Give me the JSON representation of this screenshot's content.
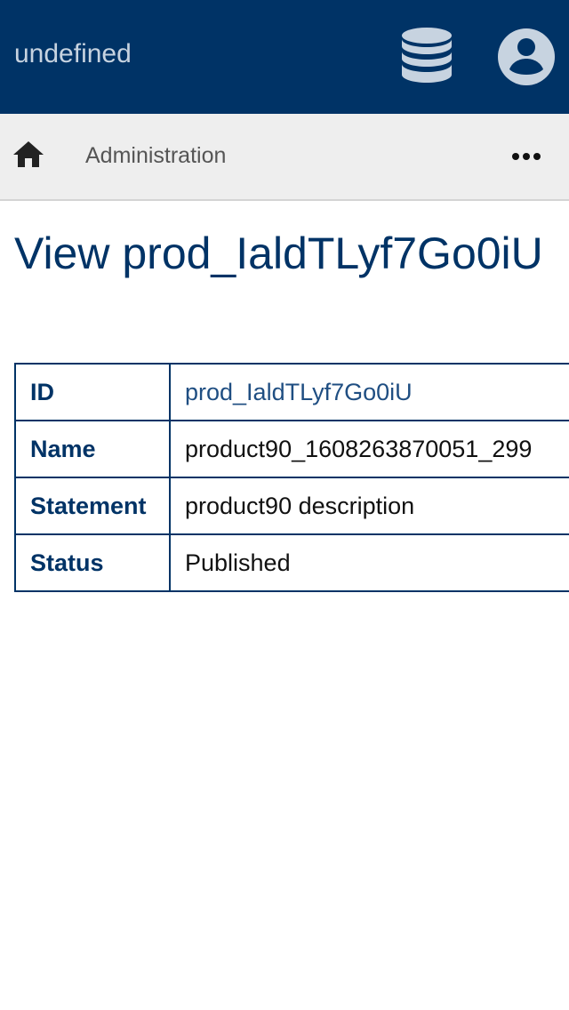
{
  "header": {
    "app_title": "undefined",
    "database_icon": "database-icon",
    "account_icon": "account-circle-icon"
  },
  "breadcrumb": {
    "home_icon": "home-icon",
    "items": [
      {
        "label": "Administration"
      }
    ],
    "more_icon": "more-horizontal-icon"
  },
  "main": {
    "title": "View prod_IaldTLyf7Go0iU",
    "details": [
      {
        "label": "ID",
        "value": "prod_IaldTLyf7Go0iU"
      },
      {
        "label": "Name",
        "value": "product90_1608263870051_299"
      },
      {
        "label": "Statement",
        "value": "product90 description"
      },
      {
        "label": "Status",
        "value": "Published"
      }
    ]
  },
  "colors": {
    "header_bg": "#003366",
    "breadcrumb_bg": "#eeeeee",
    "accent": "#003366",
    "link": "#1f4e82"
  }
}
